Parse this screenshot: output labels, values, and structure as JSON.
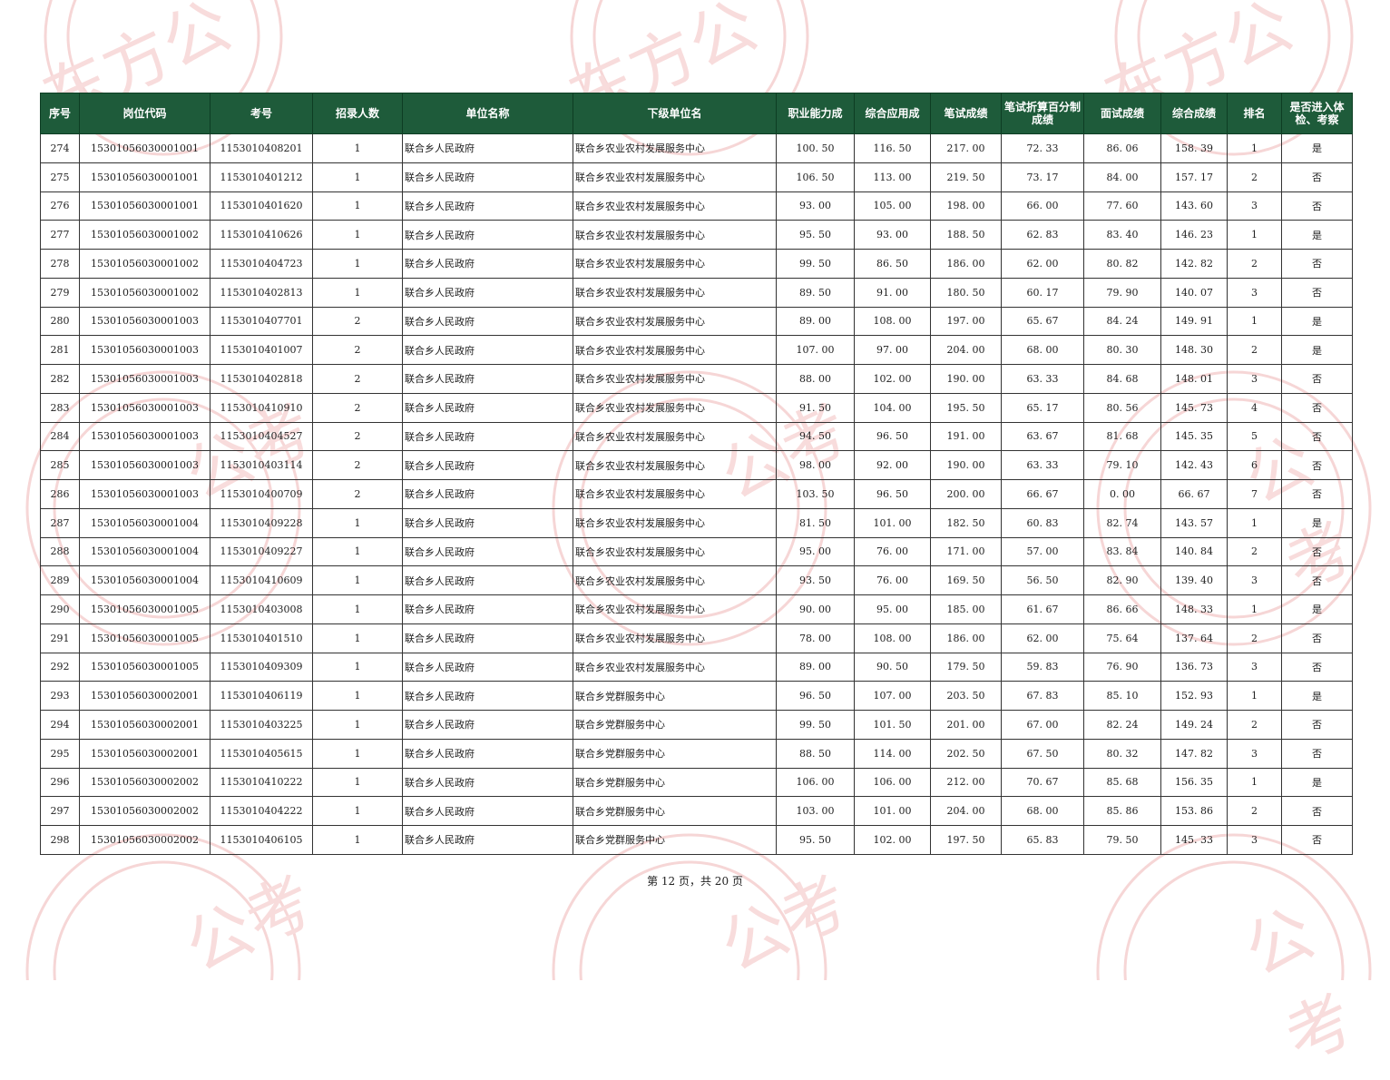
{
  "table": {
    "headers": [
      "序号",
      "岗位代码",
      "考号",
      "招录人数",
      "单位名称",
      "下级单位名",
      "职业能力成",
      "综合应用成",
      "笔试成绩",
      "笔试折算百分制成绩",
      "面试成绩",
      "综合成绩",
      "排名",
      "是否进入体检、考察"
    ],
    "rows": [
      [
        "274",
        "15301056030001001",
        "1153010408201",
        "1",
        "联合乡人民政府",
        "联合乡农业农村发展服务中心",
        "100. 50",
        "116. 50",
        "217. 00",
        "72. 33",
        "86. 06",
        "158. 39",
        "1",
        "是"
      ],
      [
        "275",
        "15301056030001001",
        "1153010401212",
        "1",
        "联合乡人民政府",
        "联合乡农业农村发展服务中心",
        "106. 50",
        "113. 00",
        "219. 50",
        "73. 17",
        "84. 00",
        "157. 17",
        "2",
        "否"
      ],
      [
        "276",
        "15301056030001001",
        "1153010401620",
        "1",
        "联合乡人民政府",
        "联合乡农业农村发展服务中心",
        "93. 00",
        "105. 00",
        "198. 00",
        "66. 00",
        "77. 60",
        "143. 60",
        "3",
        "否"
      ],
      [
        "277",
        "15301056030001002",
        "1153010410626",
        "1",
        "联合乡人民政府",
        "联合乡农业农村发展服务中心",
        "95. 50",
        "93. 00",
        "188. 50",
        "62. 83",
        "83. 40",
        "146. 23",
        "1",
        "是"
      ],
      [
        "278",
        "15301056030001002",
        "1153010404723",
        "1",
        "联合乡人民政府",
        "联合乡农业农村发展服务中心",
        "99. 50",
        "86. 50",
        "186. 00",
        "62. 00",
        "80. 82",
        "142. 82",
        "2",
        "否"
      ],
      [
        "279",
        "15301056030001002",
        "1153010402813",
        "1",
        "联合乡人民政府",
        "联合乡农业农村发展服务中心",
        "89. 50",
        "91. 00",
        "180. 50",
        "60. 17",
        "79. 90",
        "140. 07",
        "3",
        "否"
      ],
      [
        "280",
        "15301056030001003",
        "1153010407701",
        "2",
        "联合乡人民政府",
        "联合乡农业农村发展服务中心",
        "89. 00",
        "108. 00",
        "197. 00",
        "65. 67",
        "84. 24",
        "149. 91",
        "1",
        "是"
      ],
      [
        "281",
        "15301056030001003",
        "1153010401007",
        "2",
        "联合乡人民政府",
        "联合乡农业农村发展服务中心",
        "107. 00",
        "97. 00",
        "204. 00",
        "68. 00",
        "80. 30",
        "148. 30",
        "2",
        "是"
      ],
      [
        "282",
        "15301056030001003",
        "1153010402818",
        "2",
        "联合乡人民政府",
        "联合乡农业农村发展服务中心",
        "88. 00",
        "102. 00",
        "190. 00",
        "63. 33",
        "84. 68",
        "148. 01",
        "3",
        "否"
      ],
      [
        "283",
        "15301056030001003",
        "1153010410910",
        "2",
        "联合乡人民政府",
        "联合乡农业农村发展服务中心",
        "91. 50",
        "104. 00",
        "195. 50",
        "65. 17",
        "80. 56",
        "145. 73",
        "4",
        "否"
      ],
      [
        "284",
        "15301056030001003",
        "1153010404527",
        "2",
        "联合乡人民政府",
        "联合乡农业农村发展服务中心",
        "94. 50",
        "96. 50",
        "191. 00",
        "63. 67",
        "81. 68",
        "145. 35",
        "5",
        "否"
      ],
      [
        "285",
        "15301056030001003",
        "1153010403114",
        "2",
        "联合乡人民政府",
        "联合乡农业农村发展服务中心",
        "98. 00",
        "92. 00",
        "190. 00",
        "63. 33",
        "79. 10",
        "142. 43",
        "6",
        "否"
      ],
      [
        "286",
        "15301056030001003",
        "1153010400709",
        "2",
        "联合乡人民政府",
        "联合乡农业农村发展服务中心",
        "103. 50",
        "96. 50",
        "200. 00",
        "66. 67",
        "0. 00",
        "66. 67",
        "7",
        "否"
      ],
      [
        "287",
        "15301056030001004",
        "1153010409228",
        "1",
        "联合乡人民政府",
        "联合乡农业农村发展服务中心",
        "81. 50",
        "101. 00",
        "182. 50",
        "60. 83",
        "82. 74",
        "143. 57",
        "1",
        "是"
      ],
      [
        "288",
        "15301056030001004",
        "1153010409227",
        "1",
        "联合乡人民政府",
        "联合乡农业农村发展服务中心",
        "95. 00",
        "76. 00",
        "171. 00",
        "57. 00",
        "83. 84",
        "140. 84",
        "2",
        "否"
      ],
      [
        "289",
        "15301056030001004",
        "1153010410609",
        "1",
        "联合乡人民政府",
        "联合乡农业农村发展服务中心",
        "93. 50",
        "76. 00",
        "169. 50",
        "56. 50",
        "82. 90",
        "139. 40",
        "3",
        "否"
      ],
      [
        "290",
        "15301056030001005",
        "1153010403008",
        "1",
        "联合乡人民政府",
        "联合乡农业农村发展服务中心",
        "90. 00",
        "95. 00",
        "185. 00",
        "61. 67",
        "86. 66",
        "148. 33",
        "1",
        "是"
      ],
      [
        "291",
        "15301056030001005",
        "1153010401510",
        "1",
        "联合乡人民政府",
        "联合乡农业农村发展服务中心",
        "78. 00",
        "108. 00",
        "186. 00",
        "62. 00",
        "75. 64",
        "137. 64",
        "2",
        "否"
      ],
      [
        "292",
        "15301056030001005",
        "1153010409309",
        "1",
        "联合乡人民政府",
        "联合乡农业农村发展服务中心",
        "89. 00",
        "90. 50",
        "179. 50",
        "59. 83",
        "76. 90",
        "136. 73",
        "3",
        "否"
      ],
      [
        "293",
        "15301056030002001",
        "1153010406119",
        "1",
        "联合乡人民政府",
        "联合乡党群服务中心",
        "96. 50",
        "107. 00",
        "203. 50",
        "67. 83",
        "85. 10",
        "152. 93",
        "1",
        "是"
      ],
      [
        "294",
        "15301056030002001",
        "1153010403225",
        "1",
        "联合乡人民政府",
        "联合乡党群服务中心",
        "99. 50",
        "101. 50",
        "201. 00",
        "67. 00",
        "82. 24",
        "149. 24",
        "2",
        "否"
      ],
      [
        "295",
        "15301056030002001",
        "1153010405615",
        "1",
        "联合乡人民政府",
        "联合乡党群服务中心",
        "88. 50",
        "114. 00",
        "202. 50",
        "67. 50",
        "80. 32",
        "147. 82",
        "3",
        "否"
      ],
      [
        "296",
        "15301056030002002",
        "1153010410222",
        "1",
        "联合乡人民政府",
        "联合乡党群服务中心",
        "106. 00",
        "106. 00",
        "212. 00",
        "70. 67",
        "85. 68",
        "156. 35",
        "1",
        "是"
      ],
      [
        "297",
        "15301056030002002",
        "1153010404222",
        "1",
        "联合乡人民政府",
        "联合乡党群服务中心",
        "103. 00",
        "101. 00",
        "204. 00",
        "68. 00",
        "85. 86",
        "153. 86",
        "2",
        "否"
      ],
      [
        "298",
        "15301056030002002",
        "1153010406105",
        "1",
        "联合乡人民政府",
        "联合乡党群服务中心",
        "95. 50",
        "102. 00",
        "197. 50",
        "65. 83",
        "79. 50",
        "145. 33",
        "3",
        "否"
      ]
    ]
  },
  "footer": {
    "page_text": "第 12 页，共 20 页"
  },
  "watermark": {
    "text_1": "东方公",
    "text_2": "公考",
    "color": "#f3c8c8"
  },
  "colors": {
    "header_bg": "#1e5b3a",
    "header_text": "#ffffff"
  }
}
